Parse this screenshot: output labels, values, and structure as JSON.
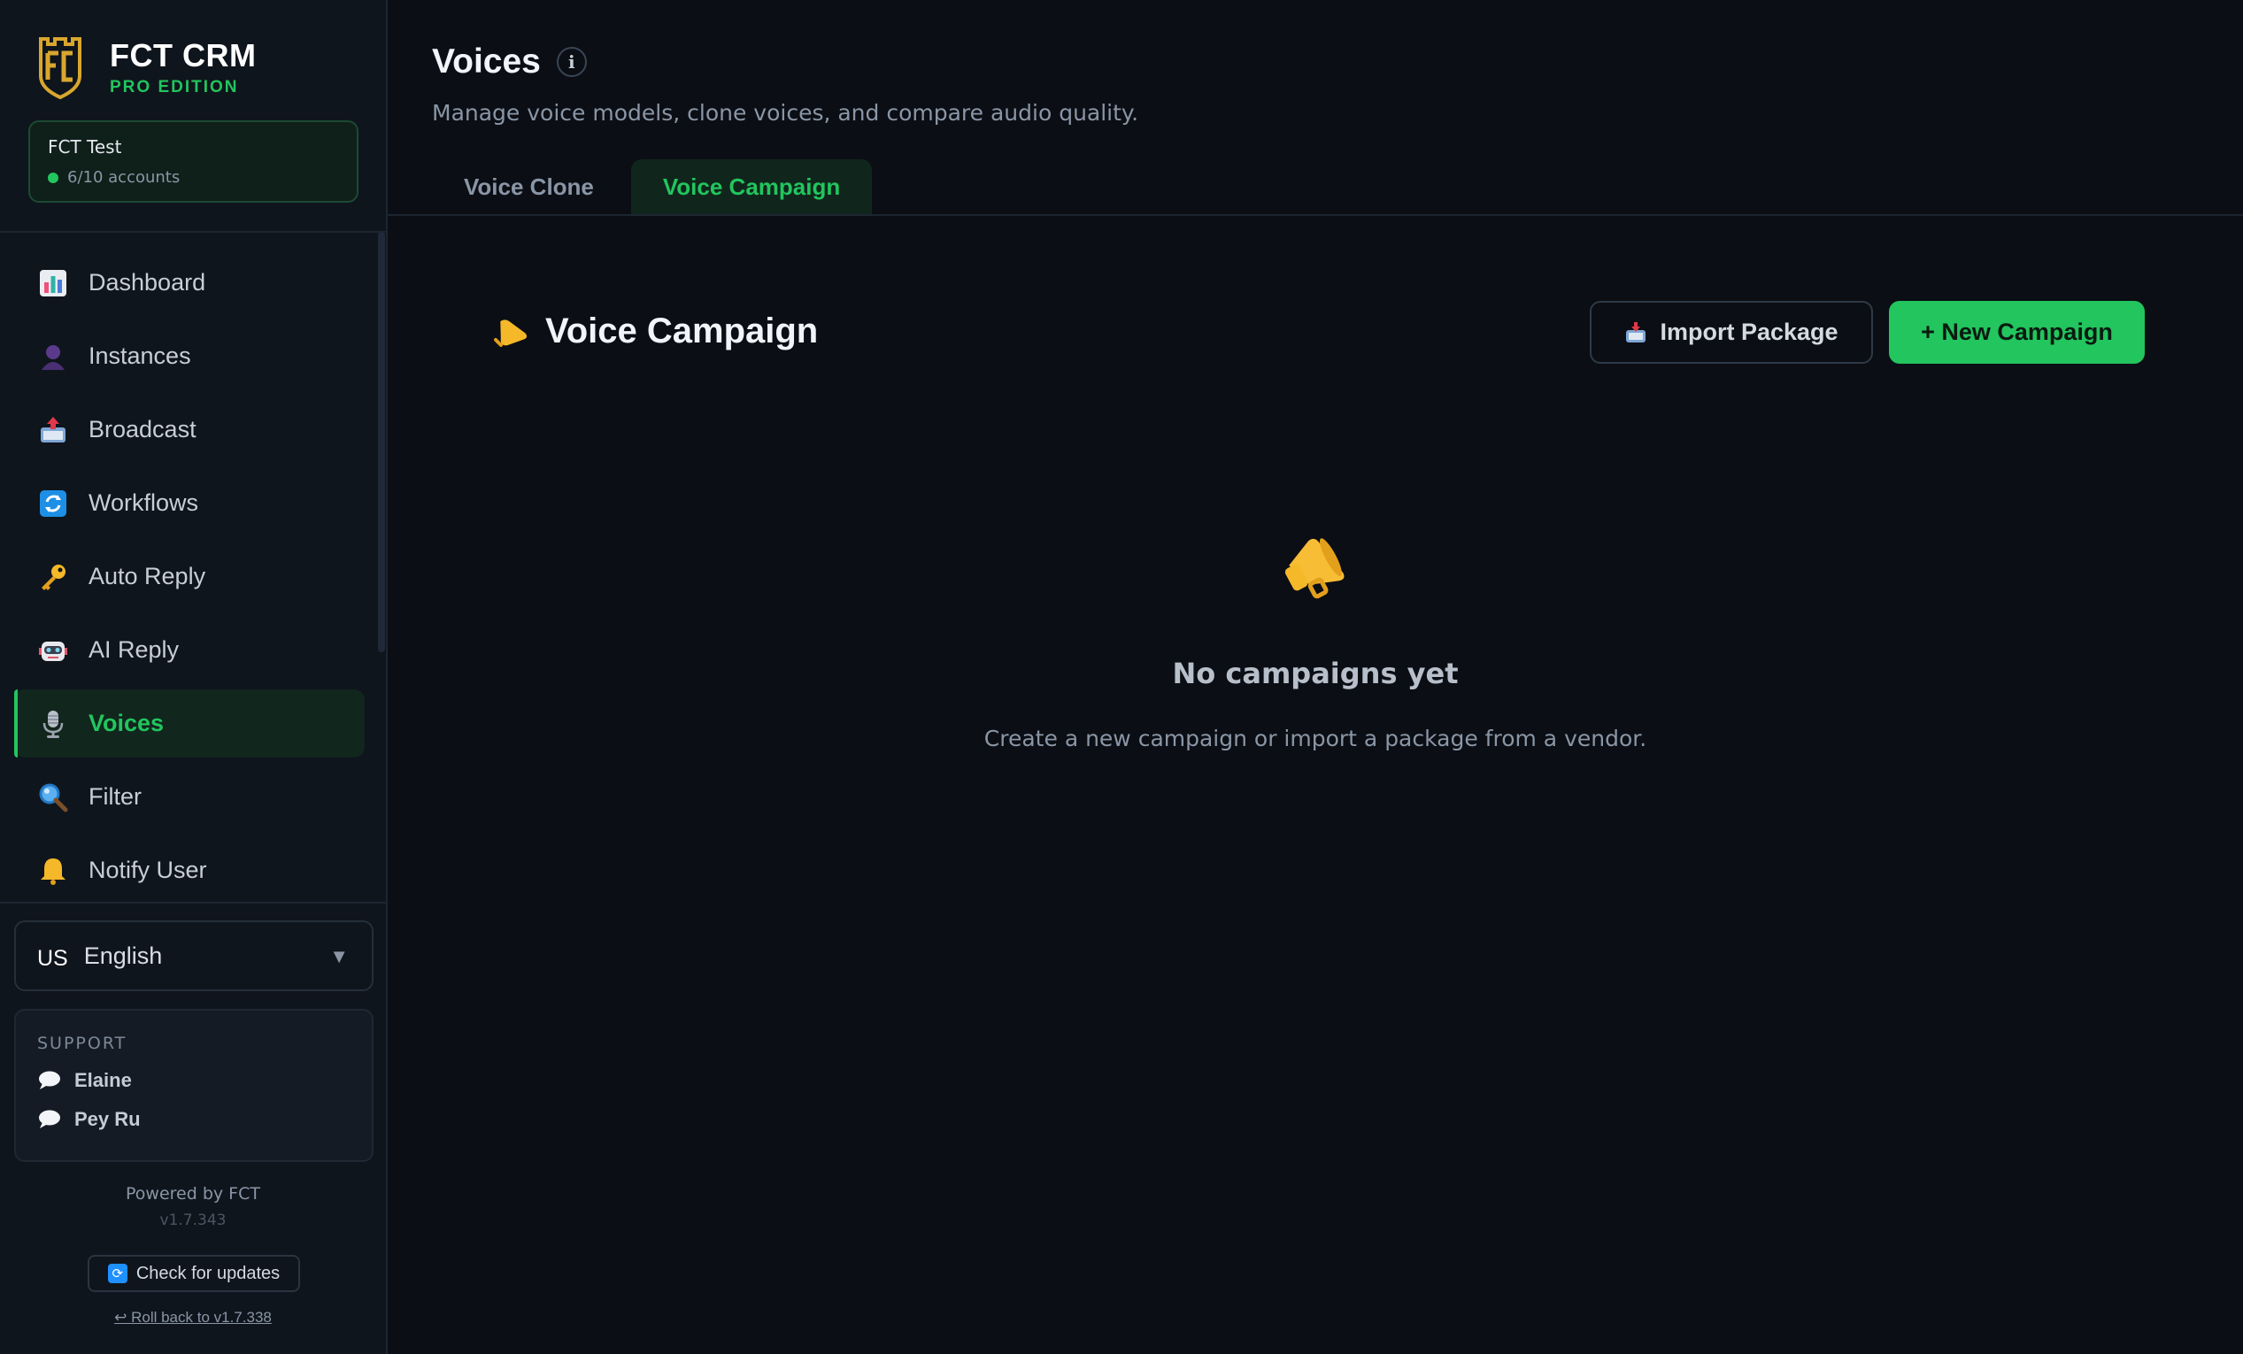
{
  "brand": {
    "name": "FCT CRM",
    "edition": "PRO EDITION",
    "accent": "#22c55e"
  },
  "account": {
    "name": "FCT Test",
    "count": "6/10 accounts"
  },
  "nav": {
    "items": [
      {
        "label": "Dashboard",
        "icon": "dashboard-chart-icon"
      },
      {
        "label": "Instances",
        "icon": "user-silhouette-icon"
      },
      {
        "label": "Broadcast",
        "icon": "outbox-tray-icon"
      },
      {
        "label": "Workflows",
        "icon": "refresh-arrows-icon"
      },
      {
        "label": "Auto Reply",
        "icon": "key-icon"
      },
      {
        "label": "AI Reply",
        "icon": "robot-icon"
      },
      {
        "label": "Voices",
        "icon": "microphone-icon",
        "active": true
      },
      {
        "label": "Filter",
        "icon": "magnifier-icon"
      },
      {
        "label": "Notify User",
        "icon": "bell-icon"
      }
    ]
  },
  "language": {
    "flag": "US",
    "value": "English"
  },
  "support": {
    "title": "SUPPORT",
    "contacts": [
      "Elaine",
      "Pey Ru"
    ]
  },
  "footer": {
    "powered": "Powered by FCT",
    "version": "v1.7.343",
    "check_updates": "Check for updates",
    "rollback": "↩ Roll back to v1.7.338"
  },
  "page": {
    "title": "Voices",
    "subtitle": "Manage voice models, clone voices, and compare audio quality.",
    "tabs": [
      {
        "label": "Voice Clone",
        "active": false
      },
      {
        "label": "Voice Campaign",
        "active": true
      }
    ]
  },
  "campaign": {
    "title": "Voice Campaign",
    "import_label": "Import Package",
    "new_label": "+ New Campaign",
    "empty_title": "No campaigns yet",
    "empty_text": "Create a new campaign or import a package from a vendor."
  }
}
